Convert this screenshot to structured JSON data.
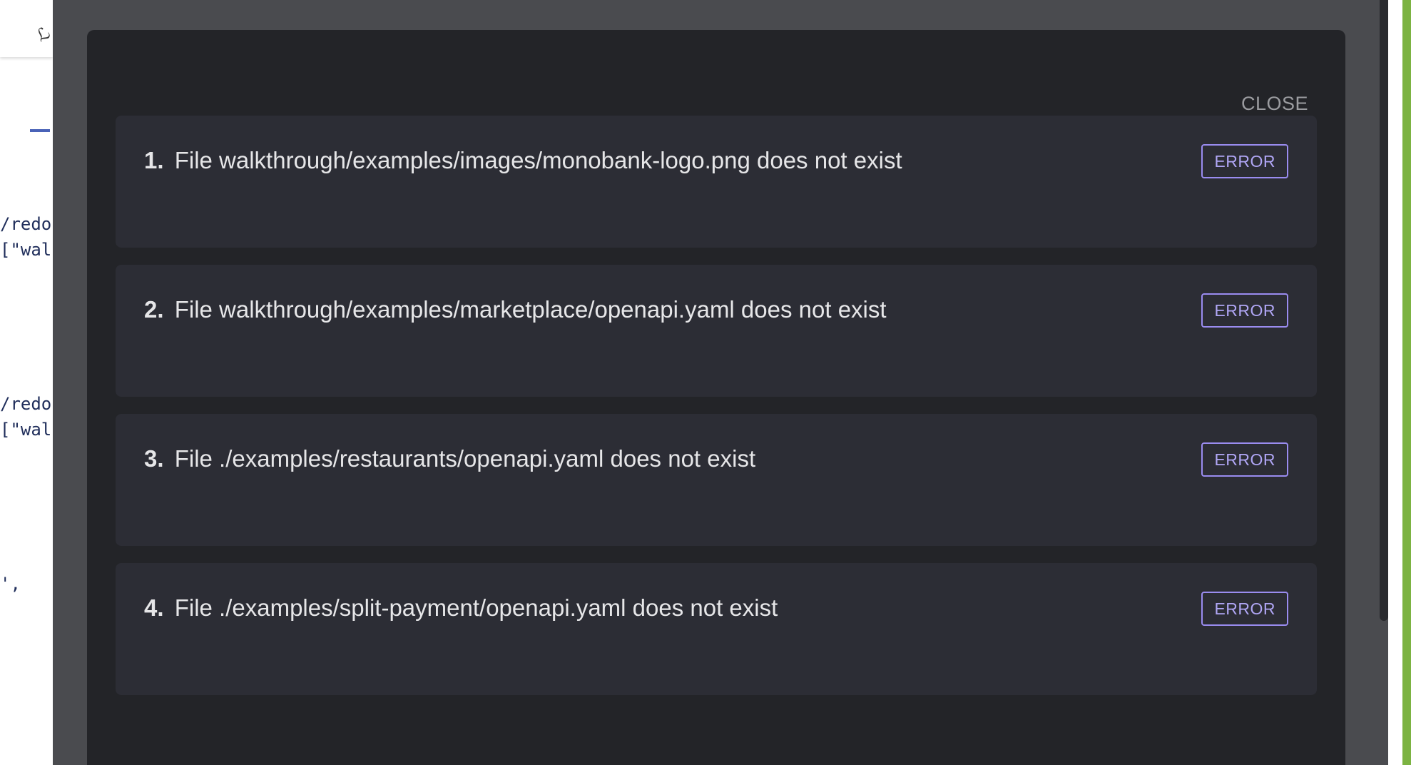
{
  "background": {
    "code_lines": [
      "/redo",
      "[\"wal",
      "/redo",
      "[\"wal",
      "',"
    ]
  },
  "modal": {
    "close_label": "CLOSE",
    "errors": [
      {
        "number": "1.",
        "message": "File walkthrough/examples/images/monobank-logo.png does not exist",
        "badge": "ERROR"
      },
      {
        "number": "2.",
        "message": "File walkthrough/examples/marketplace/openapi.yaml does not exist",
        "badge": "ERROR"
      },
      {
        "number": "3.",
        "message": "File ./examples/restaurants/openapi.yaml does not exist",
        "badge": "ERROR"
      },
      {
        "number": "4.",
        "message": "File ./examples/split-payment/openapi.yaml does not exist",
        "badge": "ERROR"
      }
    ]
  },
  "colors": {
    "overlay": "#4a4b4f",
    "modal": "#232428",
    "card": "#2c2d35",
    "badge_accent": "#9a8cf0",
    "right_strip": "#7cb342"
  }
}
